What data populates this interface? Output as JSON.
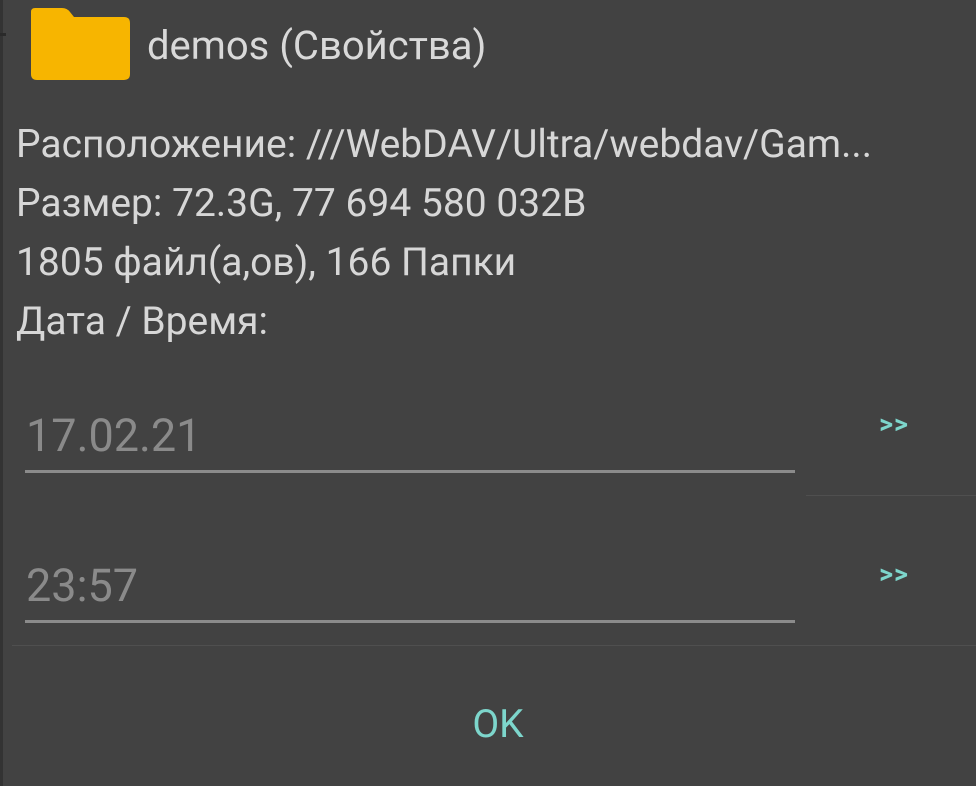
{
  "dialog": {
    "folder_icon": "folder-icon",
    "title": "demos (Свойства)",
    "location": "Расположение: ///WebDAV/Ultra/webdav/Gam...",
    "size": "Размер: 72.3G, 77 694 580 032B",
    "counts": "1805 файл(а,ов), 166 Папки",
    "datetime_label": "Дата / Время:",
    "date_value": "17.02.21",
    "time_value": "23:57",
    "date_next_label": ">>",
    "time_next_label": ">>",
    "ok_label": "OK"
  },
  "colors": {
    "background": "#424242",
    "accent": "#7dd6cc",
    "folder": "#f7b500",
    "text": "#d7d7d7",
    "muted_text": "#8a8a8a"
  }
}
